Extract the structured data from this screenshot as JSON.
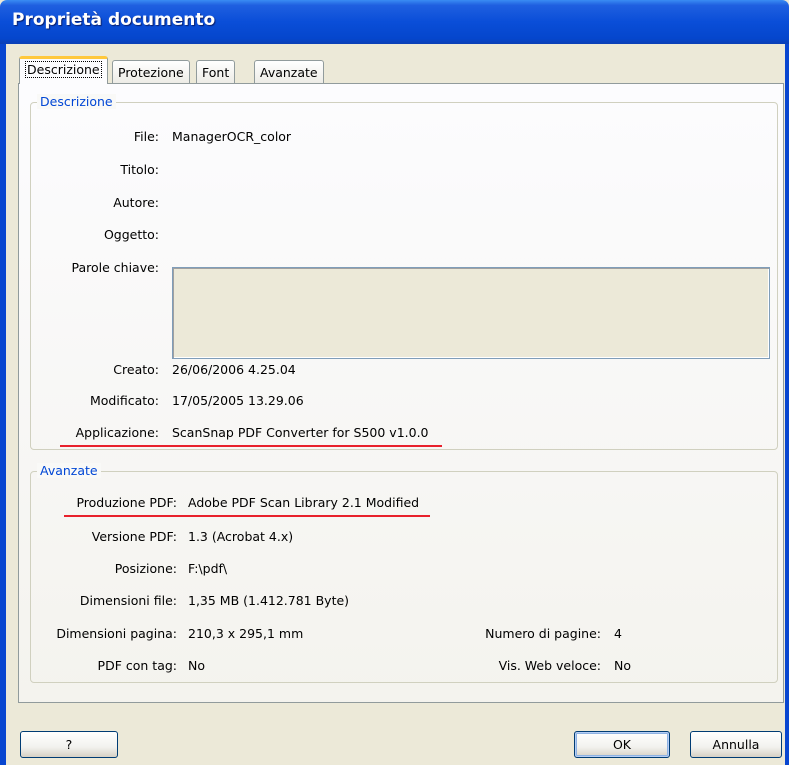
{
  "window": {
    "title": "Proprietà documento"
  },
  "tabs": [
    {
      "label": "Descrizione"
    },
    {
      "label": "Protezione"
    },
    {
      "label": "Font"
    },
    {
      "label": "Avanzate"
    }
  ],
  "descrizione": {
    "legend": "Descrizione",
    "file_label": "File:",
    "file_value": "ManagerOCR_color",
    "titolo_label": "Titolo:",
    "titolo_value": "",
    "autore_label": "Autore:",
    "autore_value": "",
    "oggetto_label": "Oggetto:",
    "oggetto_value": "",
    "parole_label": "Parole chiave:",
    "parole_value": "",
    "creato_label": "Creato:",
    "creato_value": "26/06/2006 4.25.04",
    "modificato_label": "Modificato:",
    "modificato_value": "17/05/2005 13.29.06",
    "applicazione_label": "Applicazione:",
    "applicazione_value": "ScanSnap PDF Converter for S500 v1.0.0"
  },
  "avanzate": {
    "legend": "Avanzate",
    "produzione_label": "Produzione PDF:",
    "produzione_value": "Adobe PDF Scan Library 2.1 Modified",
    "versione_label": "Versione PDF:",
    "versione_value": "1.3 (Acrobat 4.x)",
    "posizione_label": "Posizione:",
    "posizione_value": "F:\\pdf\\",
    "dimfile_label": "Dimensioni file:",
    "dimfile_value": "1,35 MB (1.412.781 Byte)",
    "dimpagina_label": "Dimensioni pagina:",
    "dimpagina_value": "210,3 x 295,1 mm",
    "numpagine_label": "Numero di pagine:",
    "numpagine_value": "4",
    "pdftag_label": "PDF con tag:",
    "pdftag_value": "No",
    "webveloce_label": "Vis. Web veloce:",
    "webveloce_value": "No"
  },
  "buttons": {
    "help": "?",
    "ok": "OK",
    "annulla": "Annulla"
  },
  "colors": {
    "title_bar": "#0a4ed8",
    "legend_text": "#0046d5",
    "highlight_underline": "#e8212b"
  }
}
